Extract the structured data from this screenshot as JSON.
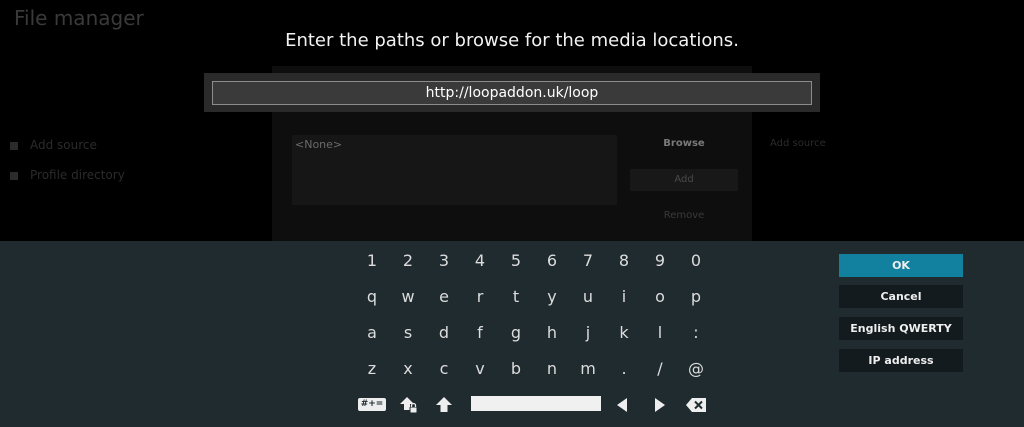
{
  "background": {
    "window_title": "File manager",
    "side_items": [
      "Add source",
      "Profile directory"
    ],
    "list_none": "<None>",
    "buttons": {
      "browse": "Browse",
      "add": "Add",
      "remove": "Remove"
    },
    "right_text": "Add source"
  },
  "dialog": {
    "heading": "Enter the paths or browse for the media locations.",
    "input_value": "http://loopaddon.uk/loop"
  },
  "keyboard": {
    "rows": [
      [
        "1",
        "2",
        "3",
        "4",
        "5",
        "6",
        "7",
        "8",
        "9",
        "0"
      ],
      [
        "q",
        "w",
        "e",
        "r",
        "t",
        "y",
        "u",
        "i",
        "o",
        "p"
      ],
      [
        "a",
        "s",
        "d",
        "f",
        "g",
        "h",
        "j",
        "k",
        "l",
        ":"
      ],
      [
        "z",
        "x",
        "c",
        "v",
        "b",
        "n",
        "m",
        ".",
        "/",
        "@"
      ]
    ],
    "symbols_label": "#+=",
    "icons": [
      "caps-lock-icon",
      "shift-icon",
      "left-arrow-icon",
      "right-arrow-icon",
      "backspace-icon"
    ]
  },
  "side_buttons": {
    "ok": "OK",
    "cancel": "Cancel",
    "layout": "English QWERTY",
    "ip": "IP address"
  },
  "colors": {
    "accent": "#12809f",
    "panel": "#202b30"
  }
}
